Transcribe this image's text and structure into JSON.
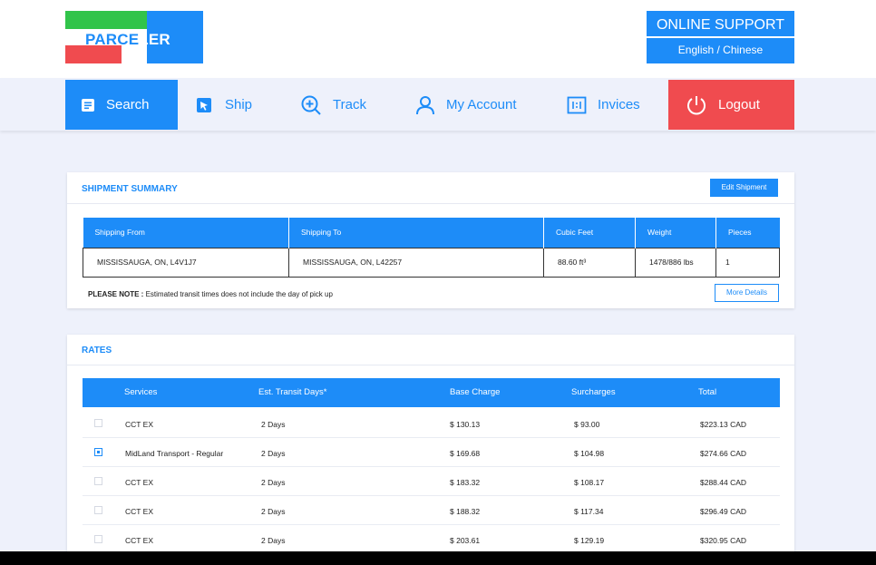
{
  "brand": {
    "logo_main": "PARCE",
    "logo_end": "LER"
  },
  "support": {
    "title": "ONLINE SUPPORT",
    "languages": "English / Chinese"
  },
  "nav": {
    "search": "Search",
    "ship": "Ship",
    "track": "Track",
    "account": "My Account",
    "invoices": "Invices",
    "logout": "Logout"
  },
  "summary": {
    "title": "SHIPMENT SUMMARY",
    "edit_button": "Edit Shipment",
    "headers": [
      "Shipping From",
      "Shipping To",
      "Cubic Feet",
      "Weight",
      "Pieces"
    ],
    "row": [
      "MISSISSAUGA, ON, L4V1J7",
      "MISSISSAUGA, ON, L42257",
      "88.60 ft³",
      "1478/886 lbs",
      "1"
    ],
    "note_label": "PLEASE NOTE :",
    "note_text": " Estimated transit times does not include the day of pick up",
    "more_button": "More Details"
  },
  "rates": {
    "title": "RATES",
    "headers": [
      "Services",
      "Est. Transit Days*",
      "Base Charge",
      "Surcharges",
      "Total"
    ],
    "rows": [
      {
        "service": "CCT EX",
        "days": "2 Days",
        "base": "$ 130.13",
        "surcharge": "$ 93.00",
        "total": "$223.13 CAD",
        "selected": false
      },
      {
        "service": "MidLand Transport - Regular",
        "days": "2 Days",
        "base": "$ 169.68",
        "surcharge": "$ 104.98",
        "total": "$274.66 CAD",
        "selected": true
      },
      {
        "service": "CCT EX",
        "days": "2 Days",
        "base": "$ 183.32",
        "surcharge": "$ 108.17",
        "total": "$288.44 CAD",
        "selected": false
      },
      {
        "service": "CCT EX",
        "days": "2 Days",
        "base": "$ 188.32",
        "surcharge": "$ 117.34",
        "total": "$296.49 CAD",
        "selected": false
      },
      {
        "service": "CCT EX",
        "days": "2 Days",
        "base": "$ 203.61",
        "surcharge": "$ 129.19",
        "total": "$320.95 CAD",
        "selected": false
      }
    ]
  },
  "colors": {
    "primary": "#1d8cf8",
    "danger": "#f04b4f",
    "green": "#31c44a",
    "background": "#eef1fb"
  }
}
